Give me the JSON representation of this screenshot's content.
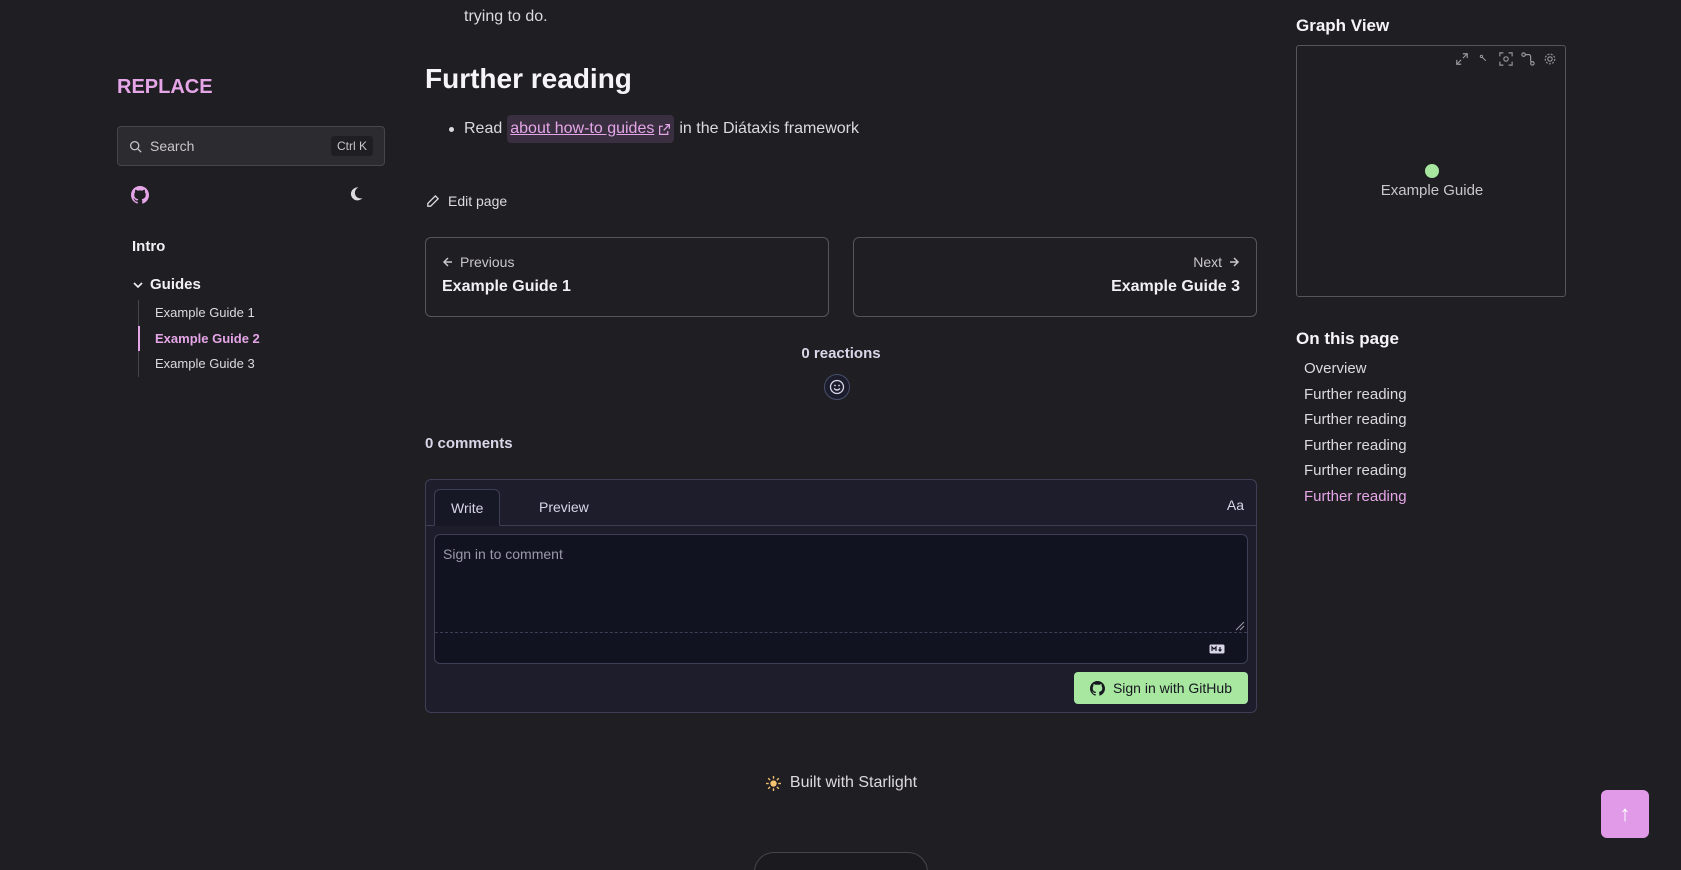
{
  "sidebar": {
    "site_title": "REPLACE",
    "search": {
      "label": "Search",
      "shortcut": "Ctrl K"
    },
    "nav": {
      "intro": "Intro",
      "group_label": "Guides",
      "items": [
        {
          "label": "Example Guide 1",
          "current": false
        },
        {
          "label": "Example Guide 2",
          "current": true
        },
        {
          "label": "Example Guide 3",
          "current": false
        }
      ]
    }
  },
  "main": {
    "intro_tail": "trying to do.",
    "heading": "Further reading",
    "reading_item": {
      "prefix": "Read",
      "link_text": "about how-to guides",
      "suffix": "in the Diátaxis framework"
    },
    "edit_page": "Edit page",
    "pagination": {
      "prev_label": "Previous",
      "prev_title": "Example Guide 1",
      "next_label": "Next",
      "next_title": "Example Guide 3"
    },
    "reactions": "0 reactions",
    "comments_count": "0 comments",
    "comment_form": {
      "write_tab": "Write",
      "preview_tab": "Preview",
      "font_toggle": "Aa",
      "placeholder": "Sign in to comment",
      "sign_in_button": "Sign in with GitHub"
    },
    "footer": "Built with Starlight"
  },
  "right": {
    "graph_heading": "Graph View",
    "graph_node": "Example Guide",
    "toc_heading": "On this page",
    "toc_items": [
      {
        "label": "Overview",
        "current": false
      },
      {
        "label": "Further reading",
        "current": false
      },
      {
        "label": "Further reading",
        "current": false
      },
      {
        "label": "Further reading",
        "current": false
      },
      {
        "label": "Further reading",
        "current": false
      },
      {
        "label": "Further reading",
        "current": true
      }
    ]
  },
  "back_to_top": "↑",
  "colors": {
    "background": "#1f1e22",
    "accent": "#e5a6e8",
    "graph_node": "#a7e7a0",
    "sign_in_button": "#a7e7a0",
    "back_to_top": "#e09ae8"
  },
  "icons": [
    "search-icon",
    "github-icon",
    "moon-icon",
    "chevron-down-icon",
    "external-link-icon",
    "pencil-icon",
    "arrow-left-icon",
    "arrow-right-icon",
    "smiley-icon",
    "markdown-icon",
    "expand-icon",
    "lock-icon",
    "focus-icon",
    "branch-icon",
    "gear-icon",
    "sun-burst-icon"
  ]
}
